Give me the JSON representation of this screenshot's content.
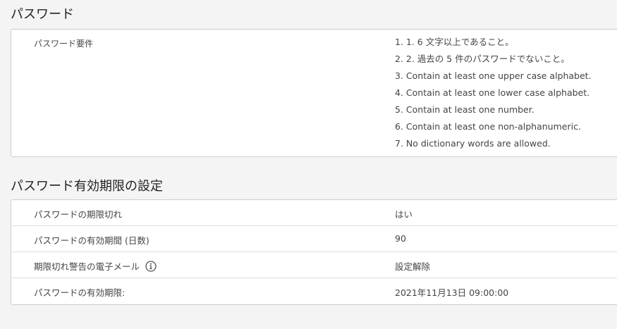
{
  "password_section": {
    "title": "パスワード",
    "requirements_label": "パスワード要件",
    "requirements": [
      "1. 1. 6 文字以上であること。",
      "2. 2. 過去の 5 件のパスワードでないこと。",
      "3. Contain at least one upper case alphabet.",
      "4. Contain at least one lower case alphabet.",
      "5. Contain at least one number.",
      "6. Contain at least one non-alphanumeric.",
      "7. No dictionary words are allowed."
    ]
  },
  "expiry_section": {
    "title": "パスワード有効期限の設定",
    "rows": [
      {
        "label": "パスワードの期限切れ",
        "value": "はい"
      },
      {
        "label": "パスワードの有効期間 (日数)",
        "value": "90"
      },
      {
        "label": "期限切れ警告の電子メール",
        "value": "設定解除",
        "icon": "info-icon"
      },
      {
        "label": "パスワードの有効期限:",
        "value": "2021年11月13日 09:00:00"
      }
    ]
  }
}
